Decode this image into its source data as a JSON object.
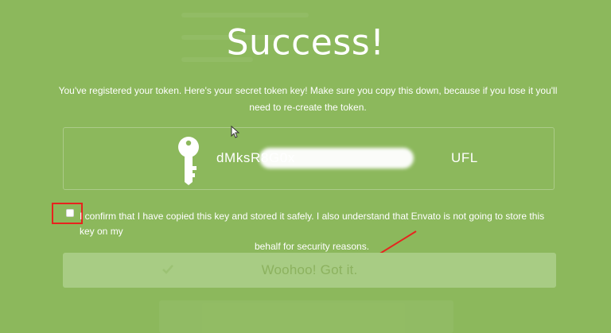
{
  "modal": {
    "title": "Success!",
    "message": "You've registered your token. Here's your secret token key! Make sure you copy this down, because if you lose it you'll need to re-create the token.",
    "token": {
      "prefix": "dMksR8G0x",
      "suffix": "UFL",
      "icon": "key-icon"
    },
    "confirm": {
      "line1": "I confirm that I have copied this key and stored it safely. I also understand that Envato is not going to store this key on my",
      "line2": "behalf for security reasons.",
      "checked": false
    },
    "button": {
      "label": "Woohoo! Got it.",
      "icon": "checkmark-icon"
    }
  },
  "colors": {
    "background": "#8cb85c",
    "button_bg": "#a8cc84",
    "button_text": "#8cb25f",
    "annotation": "#e8231e"
  }
}
